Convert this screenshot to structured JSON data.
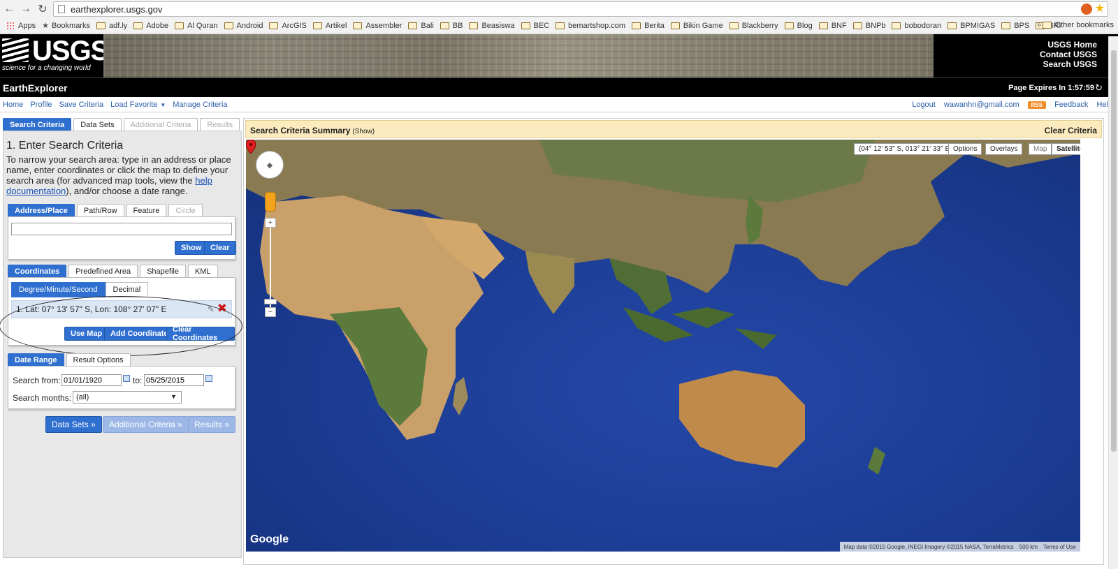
{
  "browser": {
    "url": "earthexplorer.usgs.gov",
    "bookmarks": [
      "Apps",
      "Bookmarks",
      "adf.ly",
      "Adobe",
      "Al Quran",
      "Android",
      "ArcGIS",
      "Artikel",
      "Assembler",
      "Bali",
      "BB",
      "Beasiswa",
      "BEC",
      "bemartshop.com",
      "Berita",
      "Bikin Game",
      "Blackberry",
      "Blog",
      "BNF",
      "BNPb",
      "bobodoran",
      "BPMIGAS",
      "BPS",
      "BRI"
    ],
    "more": "»",
    "other_bookmarks": "Other bookmarks"
  },
  "banner": {
    "logo_word": "USGS",
    "logo_tagline": "science for a changing world",
    "links": [
      "USGS Home",
      "Contact USGS",
      "Search USGS"
    ]
  },
  "app": {
    "title": "EarthExplorer",
    "expires": "Page Expires In 1:57:59"
  },
  "menu": {
    "left": [
      "Home",
      "Profile",
      "Save Criteria",
      "Load Favorite",
      "Manage Criteria"
    ],
    "right": [
      "Logout",
      "wawanhn@gmail.com",
      "Feedback",
      "Help"
    ],
    "rss": "RSS"
  },
  "main_tabs": [
    "Search Criteria",
    "Data Sets",
    "Additional Criteria",
    "Results"
  ],
  "step": {
    "title": "1. Enter Search Criteria",
    "desc_1": "To narrow your search area: type in an address or place name, enter coordinates or click the map to define your search area (for advanced map tools, view the ",
    "help_link": "help documentation",
    "desc_2": "), and/or choose a date range."
  },
  "address_tabs": [
    "Address/Place",
    "Path/Row",
    "Feature",
    "Circle"
  ],
  "address": {
    "value": "",
    "show": "Show",
    "clear": "Clear"
  },
  "coord_tabs": [
    "Coordinates",
    "Predefined Area",
    "Shapefile",
    "KML"
  ],
  "coords": {
    "format_tabs": [
      "Degree/Minute/Second",
      "Decimal"
    ],
    "entry": "1.  Lat: 07° 13' 57\" S, Lon: 108° 27' 07\" E",
    "use_map": "Use Map",
    "add": "Add Coordinate",
    "clear": "Clear Coordinates"
  },
  "date_tabs": [
    "Date Range",
    "Result Options"
  ],
  "date": {
    "from_label": "Search from:",
    "from": "01/01/1920",
    "to_label": "to:",
    "to": "05/25/2015",
    "months_label": "Search months:",
    "months": "(all)"
  },
  "nav_buttons": [
    "Data Sets »",
    "Additional Criteria »",
    "Results »"
  ],
  "map": {
    "summary_title": "Search Criteria Summary",
    "summary_show": "(Show)",
    "clear_criteria": "Clear Criteria",
    "cursor_coord": "(04° 12' 53\" S, 013° 21' 33\" E)",
    "options": "Options",
    "overlays": "Overlays",
    "map_btn": "Map",
    "satellite_btn": "Satellite",
    "google": "Google",
    "attribution": "Map data ©2015 Google, INEGI Imagery ©2015 NASA, TerraMetrics",
    "scale": "500 km",
    "terms": "Terms of Use"
  },
  "colors": {
    "tab_active": "#2f6fd0",
    "ocean": "#1b3c92",
    "summary_bar": "#fcebbf",
    "delete": "#d01818"
  }
}
